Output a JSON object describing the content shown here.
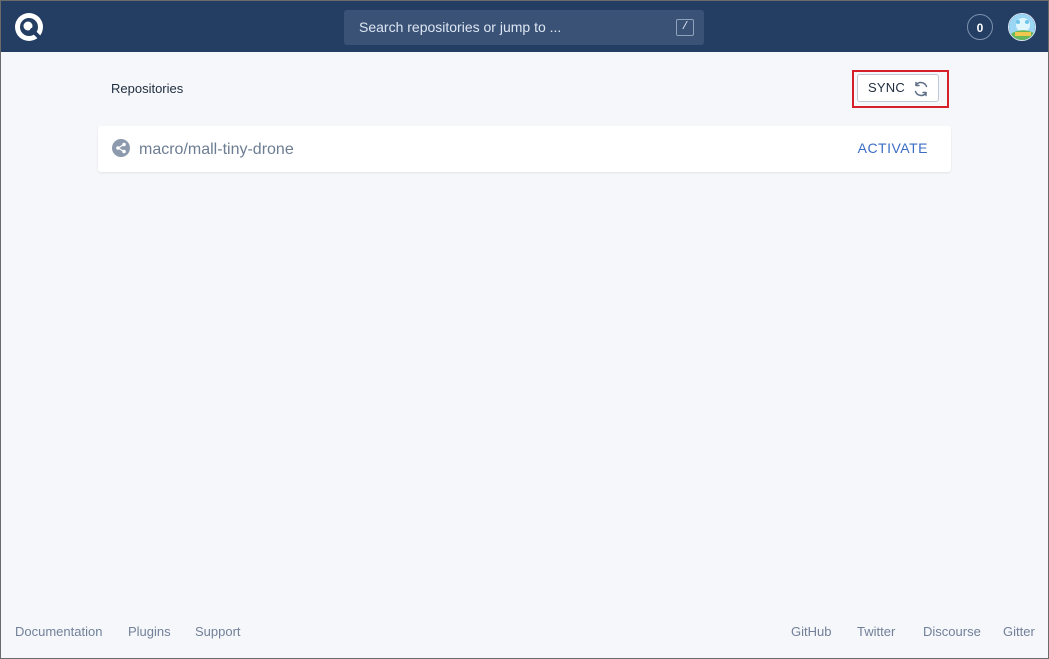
{
  "header": {
    "logo_icon": "drone-logo-icon",
    "search": {
      "placeholder": "Search repositories or jump to ...",
      "shortcut": "/"
    },
    "notifications": {
      "count": "0"
    },
    "avatar_icon": "user-avatar-icon"
  },
  "main": {
    "title": "Repositories",
    "sync_button": {
      "label": "SYNC",
      "icon": "refresh-icon"
    },
    "repositories": [
      {
        "name": "macro/mall-tiny-drone",
        "action": "ACTIVATE",
        "icon": "share-icon"
      }
    ]
  },
  "footer": {
    "left_links": [
      "Documentation",
      "Plugins",
      "Support"
    ],
    "right_links": [
      "GitHub",
      "Twitter",
      "Discourse",
      "Gitter"
    ]
  },
  "colors": {
    "header_bg": "#233d63",
    "page_bg": "#f5f7fa",
    "accent": "#3c6dc5",
    "highlight": "#d71f2b"
  }
}
